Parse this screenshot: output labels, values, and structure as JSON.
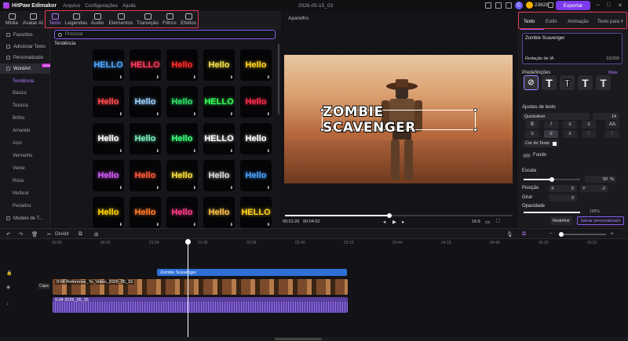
{
  "titlebar": {
    "app_name": "HitPaw Edimakor",
    "menus": [
      "Arquivo",
      "Configurações",
      "Ajuda"
    ],
    "project_name": "2026-05-15_03",
    "points": "23626",
    "export_label": "Exportar",
    "avatar_letter": "C"
  },
  "toolbar": {
    "items": [
      {
        "label": "Mídia"
      },
      {
        "label": "Avatar AI"
      },
      {
        "label": "Texto"
      },
      {
        "label": "Legendas"
      },
      {
        "label": "Áudio"
      },
      {
        "label": "Elementos"
      },
      {
        "label": "Transição"
      },
      {
        "label": "Filtros"
      },
      {
        "label": "Efeitos"
      }
    ]
  },
  "sidebar": {
    "items": [
      {
        "label": "Favoritos"
      },
      {
        "label": "Adicionar Texto"
      },
      {
        "label": "Personalizado"
      },
      {
        "label": "WordArt"
      }
    ],
    "new_tag": "NEW",
    "sub_items": [
      "Tendência",
      "Básico",
      "Textura",
      "Brilho",
      "Amarelo",
      "Azul",
      "Vermelho",
      "Verde",
      "Rosa",
      "Multicor",
      "Periados"
    ],
    "bottom_item": "Modelo de T..."
  },
  "gallery": {
    "search_placeholder": "Procurar",
    "section_title": "Tendência",
    "tiles": [
      {
        "text": "HELLO",
        "color": "#4fa8ff"
      },
      {
        "text": "HELLO",
        "color": "#ff3b5c"
      },
      {
        "text": "Hello",
        "color": "#ff2a2a"
      },
      {
        "text": "Hello",
        "color": "#f4e04a"
      },
      {
        "text": "Hello",
        "color": "#ffd21f"
      },
      {
        "text": "Hello",
        "color": "#ff4d4d"
      },
      {
        "text": "Hello",
        "color": "#9bd0ff"
      },
      {
        "text": "Hello",
        "color": "#2ee36a"
      },
      {
        "text": "HELLO",
        "color": "#39ff5a"
      },
      {
        "text": "Hello",
        "color": "#ff2d4a"
      },
      {
        "text": "Hello",
        "color": "#ffffff"
      },
      {
        "text": "Hello",
        "color": "#7af0c0"
      },
      {
        "text": "Hello",
        "color": "#3dff7a"
      },
      {
        "text": "HELLO",
        "color": "#ffffff"
      },
      {
        "text": "Hello",
        "color": "#ffffff"
      },
      {
        "text": "Hello",
        "color": "#d65cff"
      },
      {
        "text": "Hello",
        "color": "#ff5a3c"
      },
      {
        "text": "Hello",
        "color": "#ffe23a"
      },
      {
        "text": "Hello",
        "color": "#dcdcdc"
      },
      {
        "text": "Hello",
        "color": "#4aa0ff"
      },
      {
        "text": "Hello",
        "color": "#ffd400"
      },
      {
        "text": "Hello",
        "color": "#ff7a2a"
      },
      {
        "text": "Hello",
        "color": "#ff3d8a"
      },
      {
        "text": "Hello",
        "color": "#ffc14a"
      },
      {
        "text": "HELLO",
        "color": "#ffd21f"
      }
    ]
  },
  "player": {
    "header": "Aparelho",
    "caption": "ZOMBIE SCAVENGER",
    "current_time": "00:01:26",
    "total_time": "00:04:02",
    "aspect": "16:9",
    "progress": 0.46
  },
  "right_panel": {
    "tabs": [
      "Texto",
      "Estilo",
      "Animação",
      "Texto para"
    ],
    "text_value": "Zombie Scavenger",
    "ai_label": "Redação de IA",
    "char_count": "16/300",
    "presets_label": "Predefinições",
    "more_label": "Mais",
    "text_settings_label": "Ajustes de texto",
    "font": "Quicksilver",
    "font_size": "14",
    "text_color_label": "Cor do Texto",
    "background_label": "Fundo",
    "scale_label": "Escala",
    "scale_value": "50",
    "scale_unit": "%",
    "scale_level": 0.5,
    "position_label": "Posição",
    "pos_x_label": "X",
    "pos_x": "5",
    "pos_y_label": "Y",
    "pos_y": "-2",
    "rotate_label": "Girar",
    "rotate_value": "0",
    "opacity_label": "Opacidade",
    "opacity_value": "100%",
    "reset_label": "Redefinir",
    "save_custom_label": "Salvar personalizado"
  },
  "timeline_tools": {
    "split_label": "Dividir"
  },
  "timeline": {
    "ticks": [
      "00:00",
      "00:32",
      "01:04",
      "01:36",
      "02:08",
      "02:40",
      "03:12",
      "03:44",
      "04:16",
      "04:48",
      "05:20",
      "05:52"
    ],
    "text_clip": "Zombie Scavenger",
    "video_clip": "0:04  Reference_To_Video_2026_05_15",
    "audio_clip": "0:04  2026_05_15",
    "cover_label": "Capa"
  }
}
